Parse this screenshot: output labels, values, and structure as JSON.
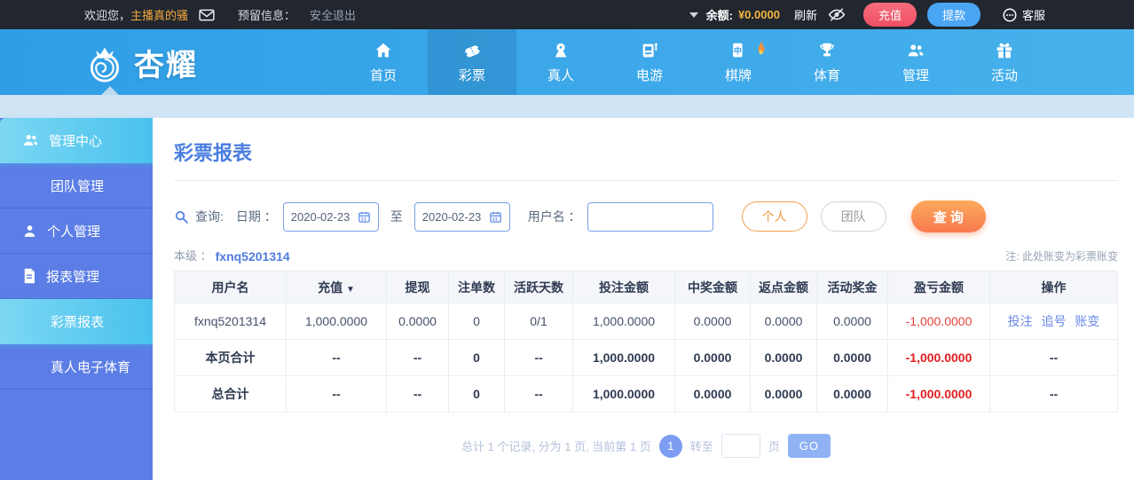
{
  "topbar": {
    "welcome_label": "欢迎您，",
    "username": "主播真的骚",
    "reserved_label": "预留信息：",
    "logout_label": "安全退出",
    "balance_label": "余额:",
    "balance_value": "¥0.0000",
    "refresh_label": "刷新",
    "recharge_label": "充值",
    "withdraw_label": "提款",
    "service_label": "客服"
  },
  "nav": {
    "brand": "杏耀",
    "items": [
      {
        "label": "首页"
      },
      {
        "label": "彩票"
      },
      {
        "label": "真人"
      },
      {
        "label": "电游"
      },
      {
        "label": "棋牌"
      },
      {
        "label": "体育"
      },
      {
        "label": "管理"
      },
      {
        "label": "活动"
      }
    ]
  },
  "sidebar": {
    "items": [
      {
        "label": "管理中心"
      },
      {
        "label": "团队管理"
      },
      {
        "label": "个人管理"
      },
      {
        "label": "报表管理"
      },
      {
        "label": "彩票报表"
      },
      {
        "label": "真人电子体育"
      }
    ]
  },
  "main": {
    "title": "彩票报表",
    "search": {
      "query_label": "查询:",
      "date_label": "日期 ：",
      "date_from": "2020-02-23",
      "to_label": "至",
      "date_to": "2020-02-23",
      "username_label": "用户名 ：",
      "username_value": "",
      "personal_label": "个人",
      "team_label": "团队",
      "search_label": "查 询"
    },
    "level_label": "本级 ：",
    "level_value": "fxnq5201314",
    "note": "注: 此处账变为彩票账变",
    "table": {
      "headers": [
        "用户名",
        "充值",
        "提现",
        "注单数",
        "活跃天数",
        "投注金额",
        "中奖金额",
        "返点金额",
        "活动奖金",
        "盈亏金额",
        "操作"
      ],
      "sort_indicator": "▼",
      "rows": [
        {
          "cells": [
            "fxnq5201314",
            "1,000.0000",
            "0.0000",
            "0",
            "0/1",
            "1,000.0000",
            "0.0000",
            "0.0000",
            "0.0000",
            "-1,000.0000"
          ],
          "actions": [
            "投注",
            "追号",
            "账变"
          ]
        },
        {
          "cells": [
            "本页合计",
            "--",
            "--",
            "0",
            "--",
            "1,000.0000",
            "0.0000",
            "0.0000",
            "0.0000",
            "-1,000.0000"
          ],
          "actions_text": "--"
        },
        {
          "cells": [
            "总合计",
            "--",
            "--",
            "0",
            "--",
            "1,000.0000",
            "0.0000",
            "0.0000",
            "0.0000",
            "-1,000.0000"
          ],
          "actions_text": "--"
        }
      ]
    },
    "pagination": {
      "summary": "总计 1 个记录, 分为 1 页, 当前第 1 页",
      "current_page": "1",
      "goto_label": "转至",
      "page_label": "页",
      "go_label": "GO"
    }
  },
  "colors": {
    "accent_orange": "#f5a93c",
    "recharge_red": "#f25b6e",
    "withdraw_blue": "#4aa5f5",
    "nav_blue": "#3aa3e8",
    "sidebar_blue": "#5b7de5",
    "active_cyan": "#55c8f0",
    "link_blue": "#5b7ce2",
    "negative_red": "#e8433c"
  }
}
